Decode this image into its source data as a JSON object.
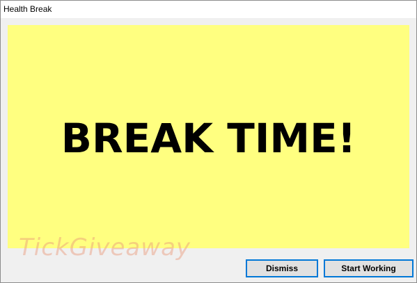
{
  "window": {
    "title": "Health Break"
  },
  "panel": {
    "message": "BREAK TIME!",
    "background_color": "#ffff80"
  },
  "watermark": {
    "text": "TickGiveaway"
  },
  "buttons": {
    "dismiss_label": "Dismiss",
    "start_working_label": "Start Working",
    "focus_border_color": "#0078d7"
  }
}
